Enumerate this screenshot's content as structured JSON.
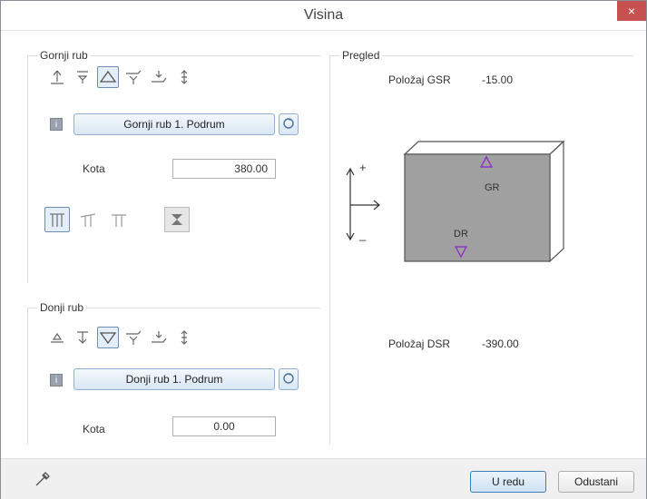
{
  "window": {
    "title": "Visina",
    "close_glyph": "×"
  },
  "top_group": {
    "label": "Gornji rub",
    "tools": [
      "up-arrow-icon",
      "down-to-line-icon",
      "triangle-up-icon",
      "plane-down-icon",
      "plane-up-icon",
      "up-down-arrow-icon"
    ],
    "selected_button_label": "Gornji rub 1. Podrum",
    "kota_label": "Kota",
    "kota_value": "380.00"
  },
  "bottom_group": {
    "label": "Donji rub",
    "tools": [
      "triangle-up-small-icon",
      "down-arrow-line-icon",
      "triangle-down-icon",
      "plane-down-icon",
      "plane-up-icon",
      "up-down-arrow-icon"
    ],
    "selected_button_label": "Donji rub 1. Podrum",
    "kota_label": "Kota",
    "kota_value": "0.00"
  },
  "preview": {
    "label": "Pregled",
    "gsr_label": "Položaj GSR",
    "gsr_value": "-15.00",
    "dsr_label": "Položaj DSR",
    "dsr_value": "-390.00",
    "plus": "+",
    "minus": "_",
    "gr_label": "GR",
    "dr_label": "DR"
  },
  "footer": {
    "ok_label": "U redu",
    "cancel_label": "Odustani"
  },
  "colors": {
    "accent": "#8e33c7",
    "block_face": "#a0a0a0",
    "button_blue": "#d9e6f4"
  }
}
